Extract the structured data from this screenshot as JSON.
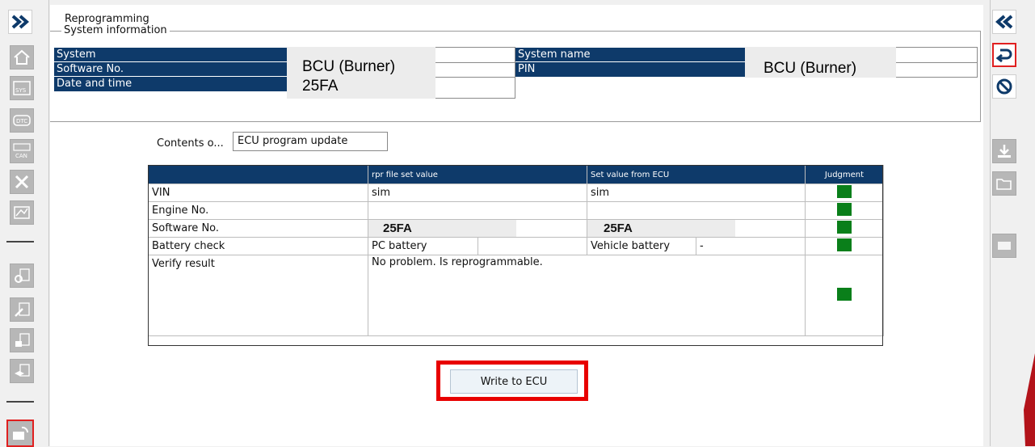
{
  "header": {
    "title": "Reprogramming",
    "section": "System information"
  },
  "system_info": {
    "system_label": "System",
    "software_no_label": "Software No.",
    "date_time_label": "Date and time",
    "system_name_label": "System name",
    "pin_label": "PIN",
    "system_value": "BCU (Burner)",
    "software_no_value": "25FA",
    "system_name_value": "BCU (Burner)"
  },
  "contents": {
    "label": "Contents o...",
    "value": "ECU program update"
  },
  "table": {
    "headers": [
      "",
      "rpr file set value",
      "Set value from ECU",
      "Judgment"
    ],
    "rows": [
      {
        "name": "VIN",
        "rpr": "sim",
        "ecu": "sim"
      },
      {
        "name": "Engine No.",
        "rpr": "",
        "ecu": ""
      },
      {
        "name": "Software No.",
        "rpr": "25FA",
        "ecu": "25FA"
      },
      {
        "name": "Battery check",
        "rpr": "PC battery",
        "ecu": "Vehicle battery",
        "ecu_extra": "-"
      },
      {
        "name": "Verify result",
        "rpr": "No problem. Is reprogrammable.",
        "ecu": ""
      }
    ]
  },
  "actions": {
    "write_label": "Write to ECU"
  },
  "colors": {
    "header_blue": "#0e3a6a",
    "ok_green": "#0a7f1a",
    "highlight_red": "#e80000"
  }
}
